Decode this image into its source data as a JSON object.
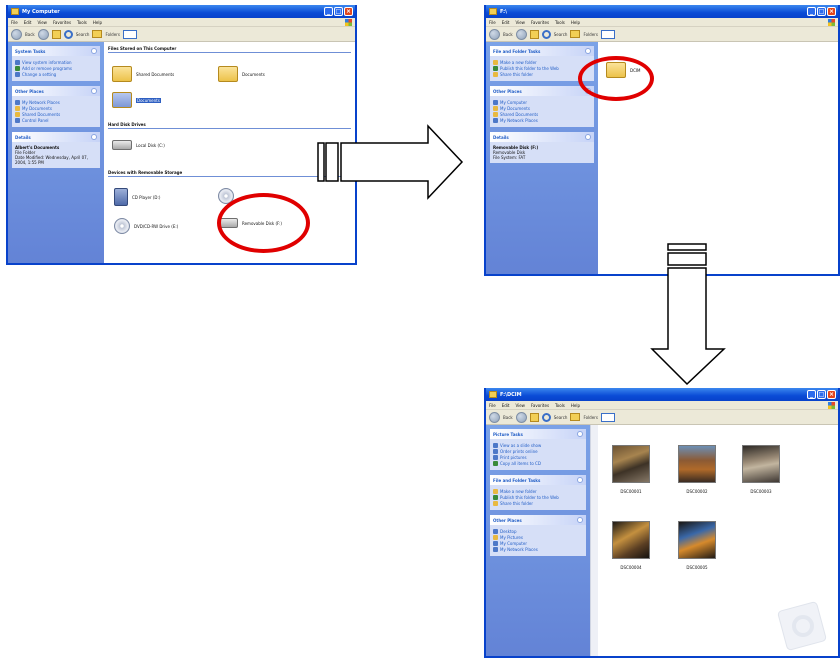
{
  "window1": {
    "title": "My Computer",
    "menu": [
      "File",
      "Edit",
      "View",
      "Favorites",
      "Tools",
      "Help"
    ],
    "toolbar": {
      "back": "Back",
      "search": "Search",
      "folders": "Folders"
    },
    "system_tasks": {
      "title": "System Tasks",
      "items": [
        "View system information",
        "Add or remove programs",
        "Change a setting"
      ]
    },
    "other_places": {
      "title": "Other Places",
      "items": [
        "My Network Places",
        "My Documents",
        "Shared Documents",
        "Control Panel"
      ]
    },
    "details": {
      "title": "Details",
      "name": "Albert's Documents",
      "type": "File Folder",
      "modified": "Date Modified: Wednesday, April 07, 2004, 1:55 PM"
    },
    "sections": {
      "files": "Files Stored on This Computer",
      "drives": "Hard Disk Drives",
      "removable": "Devices with Removable Storage"
    },
    "items": {
      "shared": "Shared Documents",
      "docs": "Documents",
      "selected": "Documents",
      "local": "Local Disk (C:)",
      "player": "CD Player (D:)",
      "floppy": "DVD/CD-RW Drive (E:)",
      "removable": "Removable Disk (F:)"
    }
  },
  "window2": {
    "title": "F:\\",
    "menu": [
      "File",
      "Edit",
      "View",
      "Favorites",
      "Tools",
      "Help"
    ],
    "toolbar": {
      "back": "Back",
      "search": "Search",
      "folders": "Folders"
    },
    "file_tasks": {
      "title": "File and Folder Tasks",
      "items": [
        "Make a new folder",
        "Publish this folder to the Web",
        "Share this folder"
      ]
    },
    "other_places": {
      "title": "Other Places",
      "items": [
        "My Computer",
        "My Documents",
        "Shared Documents",
        "My Network Places"
      ]
    },
    "details": {
      "title": "Details",
      "name": "Removable Disk (F:)",
      "type": "Removable Disk",
      "fs": "File System: FAT"
    },
    "folder": "DCIM"
  },
  "window3": {
    "title": "F:\\DCIM",
    "menu": [
      "File",
      "Edit",
      "View",
      "Favorites",
      "Tools",
      "Help"
    ],
    "toolbar": {
      "back": "Back",
      "search": "Search",
      "folders": "Folders"
    },
    "picture_tasks": {
      "title": "Picture Tasks",
      "items": [
        "View as a slide show",
        "Order prints online",
        "Print pictures",
        "Copy all items to CD"
      ]
    },
    "file_tasks": {
      "title": "File and Folder Tasks",
      "items": [
        "Make a new folder",
        "Publish this folder to the Web",
        "Share this folder"
      ]
    },
    "other_places": {
      "title": "Other Places",
      "items": [
        "Desktop",
        "My Pictures",
        "My Computer",
        "My Network Places"
      ]
    },
    "thumbs": [
      "DSC00001",
      "DSC00002",
      "DSC00003",
      "DSC00004",
      "DSC00005"
    ]
  }
}
